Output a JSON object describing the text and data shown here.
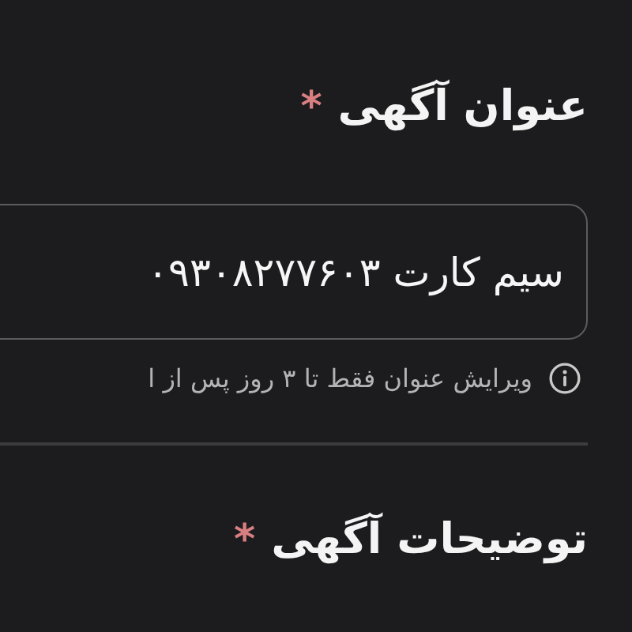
{
  "title_field": {
    "label": "عنوان آگهی",
    "required_mark": "*",
    "value": "سیم کارت ۰۹۳۰۸۲۷۷۶۰۳",
    "hint": "ویرایش عنوان فقط تا ۳ روز پس از ا"
  },
  "description_field": {
    "label": "توضیحات آگهی",
    "required_mark": "*"
  }
}
